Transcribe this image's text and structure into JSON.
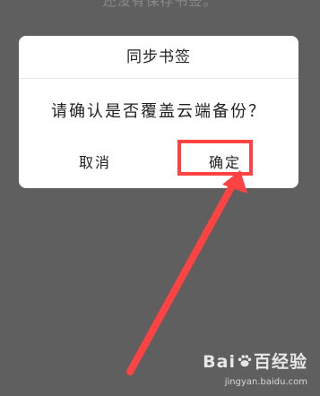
{
  "background": {
    "partial_text": "还没有保存书签。"
  },
  "dialog": {
    "title": "同步书签",
    "message": "请确认是否覆盖云端备份？",
    "cancel_label": "取消",
    "ok_label": "确定"
  },
  "annotation": {
    "highlight_color": "#ff4242",
    "arrow_color": "#ff4242"
  },
  "watermark": {
    "brand_left": "Bai",
    "brand_mid": "百",
    "brand_right": "经验",
    "url": "jingyan.baidu.com"
  }
}
